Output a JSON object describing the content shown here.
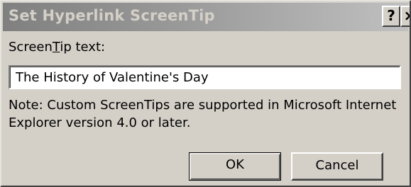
{
  "dialog": {
    "title": "Set Hyperlink ScreenTip",
    "help_button": "?",
    "close_button": "×"
  },
  "screentip": {
    "label_prefix": "Screen",
    "label_mnemonic": "T",
    "label_suffix": "ip text:",
    "value": "The History of Valentine's Day"
  },
  "note": "Note: Custom ScreenTips are supported in Microsoft Internet Explorer version 4.0 or later.",
  "buttons": {
    "ok": "OK",
    "cancel": "Cancel"
  },
  "colors": {
    "face": "#d4d0c8",
    "titlebar_start": "#808080",
    "titlebar_end": "#c0c0c0"
  }
}
